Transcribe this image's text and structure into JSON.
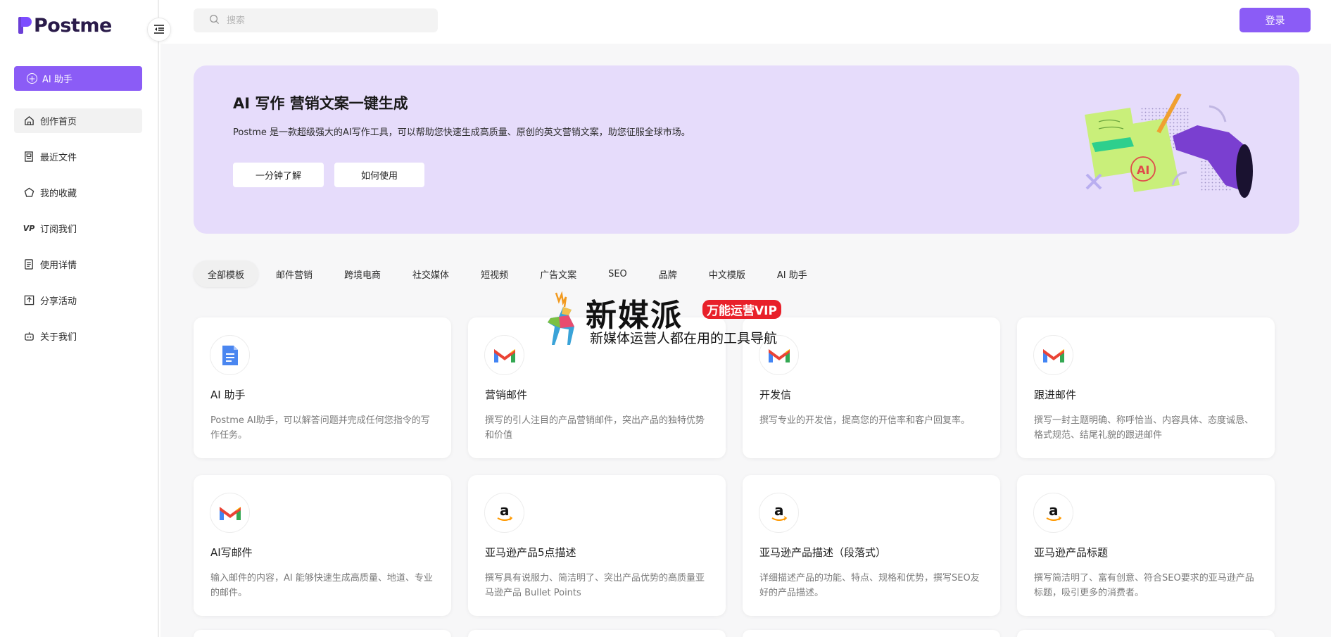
{
  "app": {
    "logo_text": "Postme"
  },
  "sidebar": {
    "ai_button": "AI 助手",
    "items": [
      {
        "label": "创作首页",
        "icon": "home-icon",
        "active": true
      },
      {
        "label": "最近文件",
        "icon": "file-icon",
        "active": false
      },
      {
        "label": "我的收藏",
        "icon": "star-icon",
        "active": false
      },
      {
        "label": "订阅我们",
        "icon": "vip-icon",
        "active": false
      },
      {
        "label": "使用详情",
        "icon": "document-icon",
        "active": false
      },
      {
        "label": "分享活动",
        "icon": "share-icon",
        "active": false
      },
      {
        "label": "关于我们",
        "icon": "robot-icon",
        "active": false
      }
    ]
  },
  "header": {
    "search_placeholder": "搜索",
    "login_label": "登录"
  },
  "hero": {
    "title": "AI 写作 营销文案一键生成",
    "description": "Postme 是一款超级强大的AI写作工具，可以帮助您快速生成高质量、原创的英文营销文案，助您征服全球市场。",
    "button_1": "一分钟了解",
    "button_2": "如何使用"
  },
  "tabs": [
    "全部模板",
    "邮件营销",
    "跨境电商",
    "社交媒体",
    "短视频",
    "广告文案",
    "SEO",
    "品牌",
    "中文模版",
    "AI 助手"
  ],
  "cards": [
    {
      "title": "AI 助手",
      "desc": "Postme AI助手，可以解答问题并完成任何您指令的写作任务。",
      "icon": "doc-blue-icon"
    },
    {
      "title": "营销邮件",
      "desc": "撰写的引人注目的产品营销邮件，突出产品的独特优势和价值",
      "icon": "gmail-icon"
    },
    {
      "title": "开发信",
      "desc": "撰写专业的开发信，提高您的开信率和客户回复率。",
      "icon": "gmail-icon"
    },
    {
      "title": "跟进邮件",
      "desc": "撰写一封主题明确、称呼恰当、内容具体、态度诚恳、格式规范、结尾礼貌的跟进邮件",
      "icon": "gmail-icon"
    },
    {
      "title": "AI写邮件",
      "desc": "输入邮件的内容，AI 能够快速生成高质量、地道、专业的邮件。",
      "icon": "gmail-icon"
    },
    {
      "title": "亚马逊产品5点描述",
      "desc": "撰写具有说服力、简洁明了、突出产品优势的高质量亚马逊产品 Bullet Points",
      "icon": "amazon-icon"
    },
    {
      "title": "亚马逊产品描述（段落式）",
      "desc": "详细描述产品的功能、特点、规格和优势，撰写SEO友好的产品描述。",
      "icon": "amazon-icon"
    },
    {
      "title": "亚马逊产品标题",
      "desc": "撰写简洁明了、富有创意、符合SEO要求的亚马逊产品标题，吸引更多的消费者。",
      "icon": "amazon-icon"
    }
  ],
  "watermark": {
    "title": "新媒派",
    "badge": "万能运营VIP",
    "subtitle": "新媒体运营人都在用的工具导航"
  },
  "colors": {
    "accent": "#8b5cf6",
    "hero_bg": "#e6dcfb"
  }
}
